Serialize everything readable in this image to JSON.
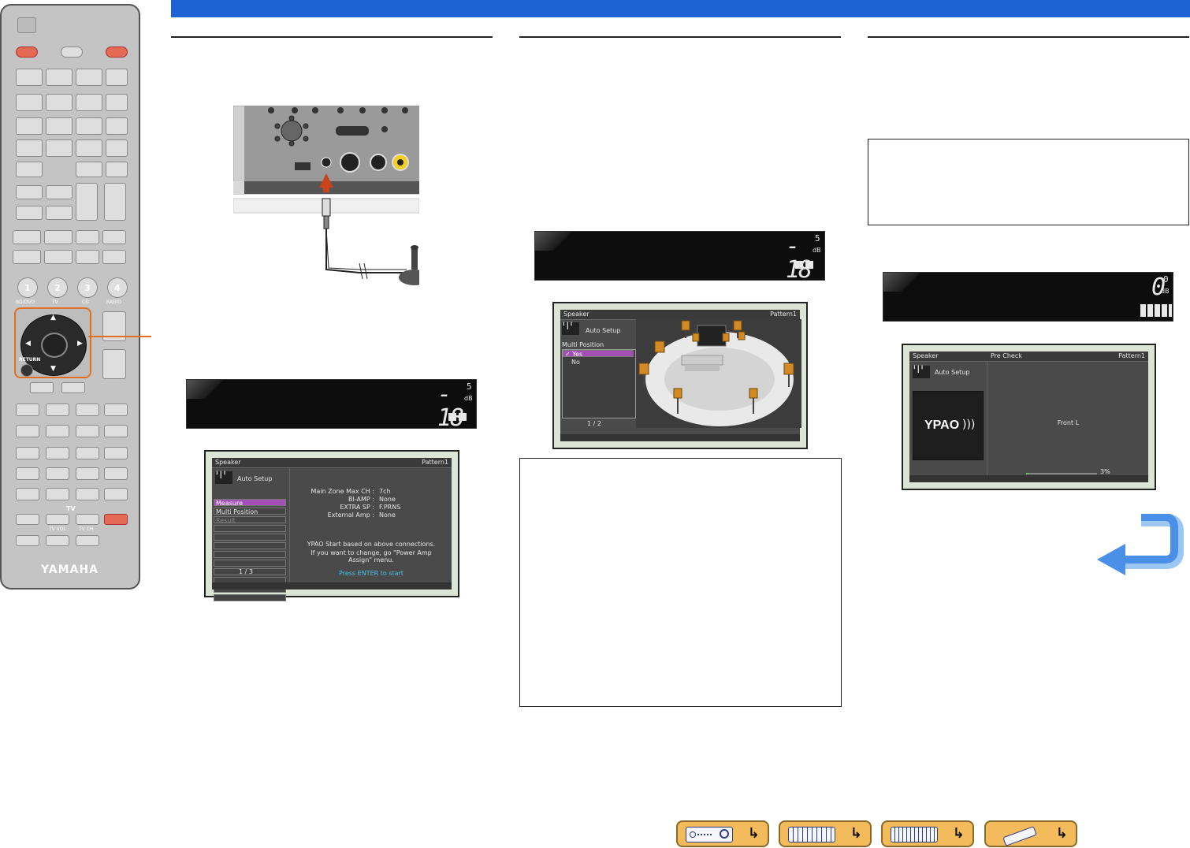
{
  "colors": {
    "header_bar": "#1e63d6",
    "remote_highlight": "#e0701f",
    "arrow_blue": "#4a8fe8",
    "nav_button": "#f3bb5b"
  },
  "remote": {
    "brand": "YAMAHA",
    "input_buttons": [
      {
        "number": "1",
        "label": "BD/DVD"
      },
      {
        "number": "2",
        "label": "TV"
      },
      {
        "number": "3",
        "label": "CD"
      },
      {
        "number": "4",
        "label": "RADIO"
      }
    ],
    "return_label": "RETURN",
    "tv_label": "TV",
    "tv_vol_label": "TV VOL",
    "tv_ch_label": "TV CH"
  },
  "col1": {
    "display": {
      "value": "- 18",
      "decimal": "5",
      "unit": "dB"
    },
    "osd": {
      "header_left": "Speaker",
      "header_right": "Pattern1",
      "title": "Auto Setup",
      "menu": [
        "Measure",
        "Multi Position",
        "Result"
      ],
      "page": "1 / 3",
      "info_labels": [
        "Main Zone Max CH :",
        "BI-AMP :",
        "EXTRA SP :",
        "External Amp :"
      ],
      "info_values": [
        "7ch",
        "None",
        "F.PRNS",
        "None"
      ],
      "message1": "YPAO Start based on above connections.",
      "message2": "If you want to change, go \"Power Amp",
      "message3": "Assign\" menu.",
      "prompt": "Press ENTER to start"
    }
  },
  "col2": {
    "display": {
      "value": "- 18",
      "decimal": "5",
      "unit": "dB"
    },
    "osd": {
      "header_left": "Speaker",
      "header_right": "Pattern1",
      "title": "Auto Setup",
      "subtitle": "Multi Position",
      "options": [
        "✓ Yes",
        "No"
      ],
      "page": "1 / 2"
    }
  },
  "col3": {
    "display": {
      "value": "0",
      "decimal": "0",
      "unit": "dB"
    },
    "osd": {
      "header_left": "Speaker",
      "header_mid": "Pre Check",
      "header_right": "Pattern1",
      "title": "Auto Setup",
      "logo": "YPAO",
      "channel": "Front L",
      "progress_label": "3%",
      "progress": 0.03
    }
  }
}
